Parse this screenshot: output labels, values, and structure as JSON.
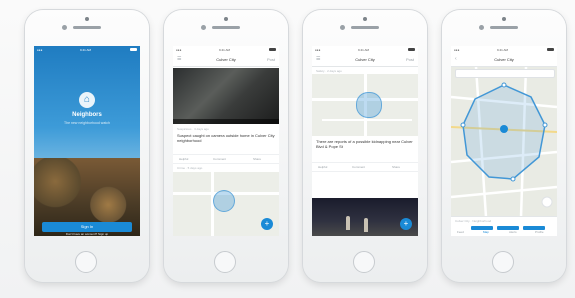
{
  "phones": [
    {
      "status_time": "9:41 AM",
      "app_name": "Neighbors",
      "tagline": "The new neighborhood watch",
      "signin_label": "Sign In",
      "subtext": "Don't have an account? Sign up"
    },
    {
      "status_time": "9:41 AM",
      "nav_title": "Culver City",
      "nav_right": "Post",
      "post_meta": "Suspicious · 3 days ago",
      "post_text": "Suspect caught on camera outside home in Culver City neighborhood",
      "actions": [
        "Helpful",
        "Comment",
        "Share"
      ],
      "second_meta": "Crime · 5 days ago",
      "fab_icon": "plus-icon"
    },
    {
      "status_time": "9:41 AM",
      "nav_title": "Culver City",
      "nav_right": "Post",
      "post_meta": "Safety · 2 days ago",
      "post_text": "There are reports of a possible kidnapping near Culver Blvd & Pope St",
      "actions": [
        "Helpful",
        "Comment",
        "Share"
      ],
      "fab_icon": "plus-icon"
    },
    {
      "status_time": "9:41 AM",
      "nav_title": "Culver City",
      "nav_right": "",
      "sheet_title": "Culver City · Neighborhood",
      "tabs": [
        "Feed",
        "Map",
        "Alerts",
        "Profile"
      ]
    }
  ],
  "colors": {
    "accent": "#1a8ad6",
    "sky": "#2a86c8",
    "map_area": "#4297d6"
  }
}
